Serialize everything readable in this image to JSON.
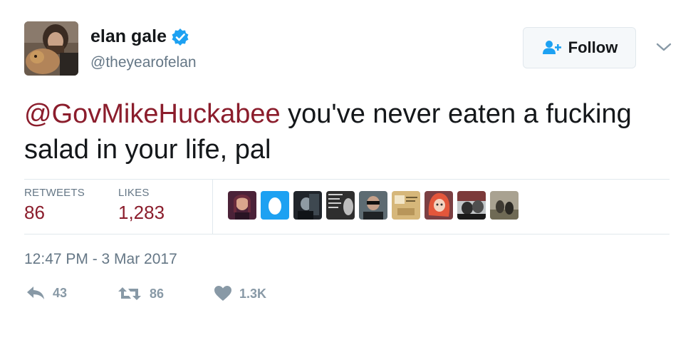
{
  "author": {
    "name": "elan gale",
    "handle": "@theyearofelan",
    "verified_icon": "verified-badge-icon",
    "avatar_icon": "avatar-photo"
  },
  "follow_button": {
    "label": "Follow",
    "icon": "follow-user-icon"
  },
  "menu": {
    "icon": "chevron-down-icon"
  },
  "tweet": {
    "mention": "@GovMikeHuckabee",
    "text": " you've never eaten a fucking salad in your life, pal"
  },
  "stats": {
    "retweets_label": "RETWEETS",
    "retweets_value": "86",
    "likes_label": "LIKES",
    "likes_value": "1,283"
  },
  "timestamp": "12:47 PM - 3 Mar 2017",
  "actions": {
    "reply_count": "43",
    "retweet_count": "86",
    "like_count": "1.3K"
  },
  "colors": {
    "accent": "#8b1d2c",
    "verified": "#1da1f2",
    "muted": "#657786",
    "action": "#8899a6"
  }
}
